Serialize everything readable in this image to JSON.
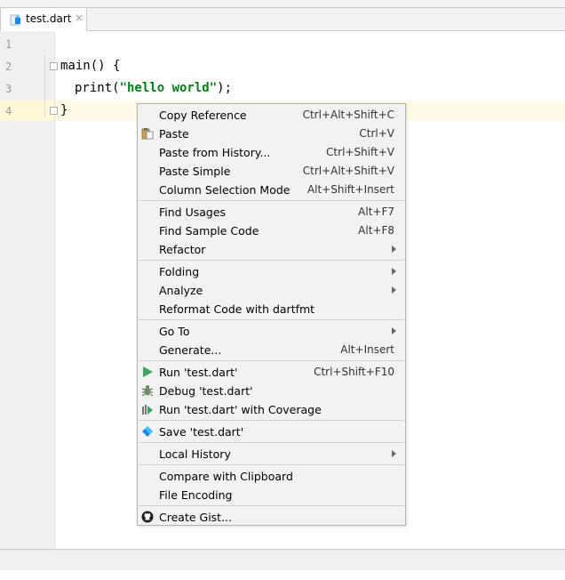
{
  "tab": {
    "title": "test.dart",
    "close": "×"
  },
  "editor": {
    "line_numbers": [
      "1",
      "2",
      "3",
      "4"
    ],
    "line2": "main() {",
    "line3_pre": "print(",
    "line3_str": "\"hello world\"",
    "line3_post": ");",
    "line4": "}"
  },
  "context_menu": {
    "copy_reference": {
      "label": "Copy Reference",
      "shortcut": "Ctrl+Alt+Shift+C"
    },
    "paste": {
      "label": "Paste",
      "shortcut": "Ctrl+V"
    },
    "paste_history": {
      "label": "Paste from History...",
      "shortcut": "Ctrl+Shift+V"
    },
    "paste_simple": {
      "label": "Paste Simple",
      "shortcut": "Ctrl+Alt+Shift+V"
    },
    "column_mode": {
      "label": "Column Selection Mode",
      "shortcut": "Alt+Shift+Insert"
    },
    "find_usages": {
      "label": "Find Usages",
      "shortcut": "Alt+F7"
    },
    "find_sample": {
      "label": "Find Sample Code",
      "shortcut": "Alt+F8"
    },
    "refactor": {
      "label": "Refactor"
    },
    "folding": {
      "label": "Folding"
    },
    "analyze": {
      "label": "Analyze"
    },
    "reformat": {
      "label": "Reformat Code with dartfmt"
    },
    "goto": {
      "label": "Go To"
    },
    "generate": {
      "label": "Generate...",
      "shortcut": "Alt+Insert"
    },
    "run": {
      "label": "Run 'test.dart'",
      "shortcut": "Ctrl+Shift+F10"
    },
    "debug": {
      "label": "Debug 'test.dart'"
    },
    "run_coverage": {
      "label": "Run 'test.dart' with Coverage"
    },
    "save": {
      "label": "Save 'test.dart'"
    },
    "local_history": {
      "label": "Local History"
    },
    "compare_clipboard": {
      "label": "Compare with Clipboard"
    },
    "file_encoding": {
      "label": "File Encoding"
    },
    "create_gist": {
      "label": "Create Gist..."
    }
  },
  "colors": {
    "run_green": "#3ba55d",
    "dart_blue": "#1e88e5",
    "string_green": "#067d17"
  }
}
